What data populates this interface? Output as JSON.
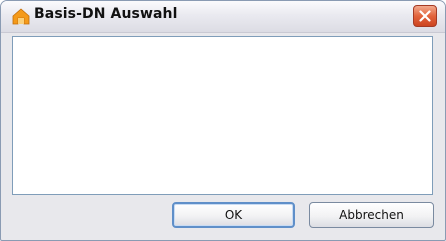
{
  "window": {
    "title": "Basis-DN Auswahl",
    "icon": "home-icon",
    "close_icon": "close-icon"
  },
  "buttons": {
    "ok_label": "OK",
    "cancel_label": "Abbrechen"
  },
  "colors": {
    "icon_orange": "#f49a1a",
    "close_red": "#e2633c",
    "focus_border": "#5f8fc9"
  }
}
